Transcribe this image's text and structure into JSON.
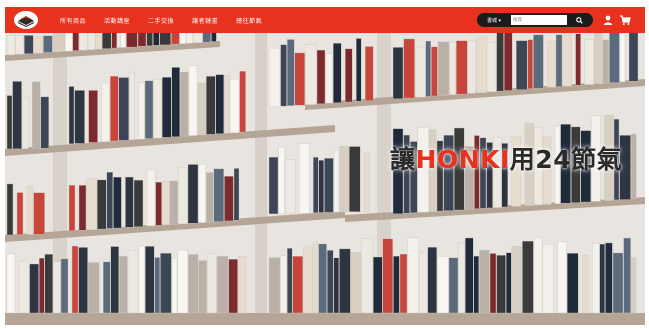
{
  "colors": {
    "brand_red": "#e8321e",
    "search_bg": "#1b1b1b",
    "shelf_wood": "#b5a596",
    "wall": "#e8e4df"
  },
  "header": {
    "logo_icon": "book-stack-logo",
    "nav": [
      {
        "label": "所有商品"
      },
      {
        "label": "活動講座"
      },
      {
        "label": "二手交換"
      },
      {
        "label": "讓者鏈書"
      },
      {
        "label": "總往節氣"
      }
    ],
    "search": {
      "category_label": "書城 ▾",
      "placeholder": "搜尋",
      "search_icon": "magnifier-icon"
    },
    "user_icon": "user-icon",
    "cart_icon": "cart-icon"
  },
  "hero": {
    "title_prefix": "讓",
    "title_accent": "HONKI",
    "title_suffix": "用24節氣"
  }
}
